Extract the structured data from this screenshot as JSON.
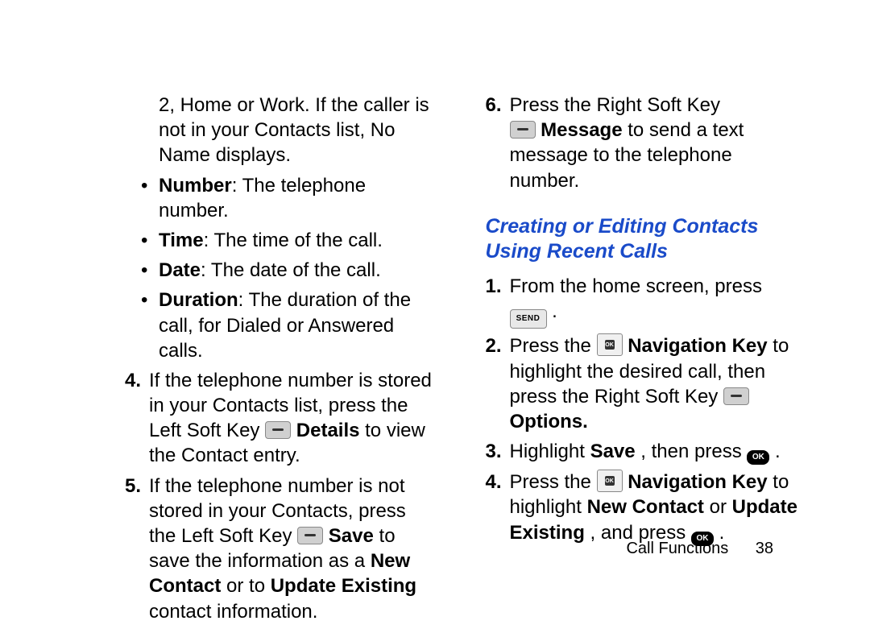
{
  "left": {
    "intro": "2, Home or Work. If the caller is not in your Contacts list, No Name displays.",
    "bullets": [
      {
        "label": "Number",
        "text": ": The telephone number."
      },
      {
        "label": "Time",
        "text": ": The time of the call."
      },
      {
        "label": "Date",
        "text": ": The date of the call."
      },
      {
        "label": "Duration",
        "text": ": The duration of the call, for Dialed or Answered calls."
      }
    ],
    "item4": {
      "num": "4.",
      "pre": "If the telephone number is stored in your Contacts list, press the Left Soft Key ",
      "bold1": " Details",
      "post": " to view the Contact entry."
    },
    "item5": {
      "num": "5.",
      "pre": "If the telephone number is not stored in your Contacts, press the Left Soft Key ",
      "bold1": " Save",
      "mid": " to save the information as a ",
      "bold2": "New Contact",
      "mid2": " or to ",
      "bold3": "Update Existing",
      "post": " contact information."
    }
  },
  "right": {
    "item6": {
      "num": "6.",
      "line1": "Press the Right Soft Key ",
      "bold1": " Message",
      "post": " to send a text message to the telephone number."
    },
    "heading": "Creating or Editing Contacts Using Recent Calls",
    "s1": {
      "num": "1.",
      "pre": "From the home screen, press ",
      "post": " ."
    },
    "s2": {
      "num": "2.",
      "pre": "Press the ",
      "bold1": " Navigation Key",
      "mid": " to highlight the desired call, then press the Right Soft Key  ",
      "bold2": " Options."
    },
    "s3": {
      "num": "3.",
      "pre": "Highlight ",
      "bold1": "Save",
      "mid": ", then press ",
      "post": " ."
    },
    "s4": {
      "num": "4.",
      "pre": "Press the ",
      "bold1": " Navigation Key",
      "mid": " to highlight ",
      "bold2": "New Contact",
      "mid2": " or ",
      "bold3": "Update Existing",
      "mid3": ", and press ",
      "post": " ."
    }
  },
  "icons": {
    "send": "SEND",
    "ok": "OK"
  },
  "footer": {
    "section": "Call Functions",
    "page": "38"
  }
}
